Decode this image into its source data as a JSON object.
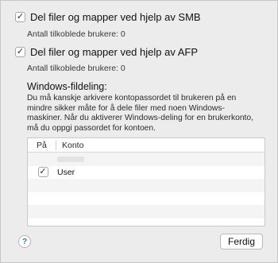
{
  "smb": {
    "checked_glyph": "✓",
    "label": "Del filer og mapper ved hjelp av SMB",
    "count_text": "Antall tilkoblede brukere: 0"
  },
  "afp": {
    "checked_glyph": "✓",
    "label": "Del filer og mapper ved hjelp av AFP",
    "count_text": "Antall tilkoblede brukere: 0"
  },
  "windows_sharing": {
    "title": "Windows-fildeling:",
    "description": "Du må kanskje arkivere kontopassordet til brukeren på en mindre sikker måte for å dele filer med noen Windows-maskiner. Når du aktiverer Windows-deling for en brukerkonto, må du oppgi passordet for kontoen.",
    "table": {
      "columns": [
        "På",
        "Konto"
      ],
      "rows": [
        {
          "on": false,
          "account": "",
          "redacted": true
        },
        {
          "on": true,
          "account": "User",
          "redacted": false
        }
      ]
    }
  },
  "footer": {
    "help_glyph": "?",
    "done_label": "Ferdig"
  }
}
